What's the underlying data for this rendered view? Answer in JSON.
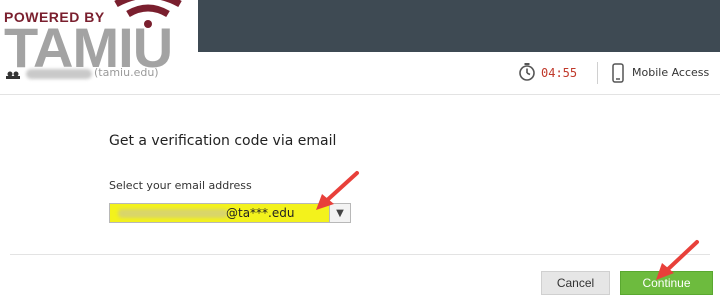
{
  "branding": {
    "powered_by": "POWERED BY",
    "name": "TAMIU"
  },
  "header": {
    "user_domain": "(tamiu.edu)",
    "timer": "04:55",
    "mobile_access": "Mobile Access"
  },
  "main": {
    "title": "Get a verification code via email",
    "email_label": "Select your email address",
    "selected_email_suffix": "@ta***.edu"
  },
  "buttons": {
    "cancel": "Cancel",
    "continue": "Continue"
  },
  "colors": {
    "topbar": "#3e4a53",
    "brand": "#7a1f2e",
    "timer": "#c0392b",
    "highlight": "#f3f21c",
    "continue": "#6dbb3e",
    "annotation_arrow": "#e8403a"
  },
  "icons": [
    "wifi-logo-icon",
    "user-icon",
    "timer-icon",
    "phone-icon",
    "chevron-down-icon",
    "red-arrow-icon"
  ]
}
